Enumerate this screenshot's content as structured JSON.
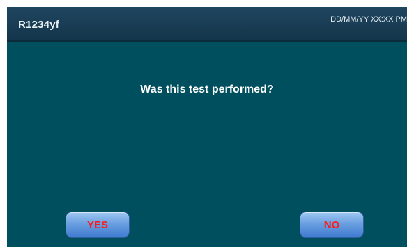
{
  "header": {
    "title": "R1234yf",
    "datetime": "DD/MM/YY XX:XX PM"
  },
  "dialog": {
    "question": "Was this test performed?"
  },
  "buttons": {
    "yes_label": "YES",
    "no_label": "NO"
  },
  "colors": {
    "background": "#004f5e",
    "header": "#1f4660",
    "button_text": "#ff1a1a",
    "button_fill": "#6a9fe0"
  }
}
